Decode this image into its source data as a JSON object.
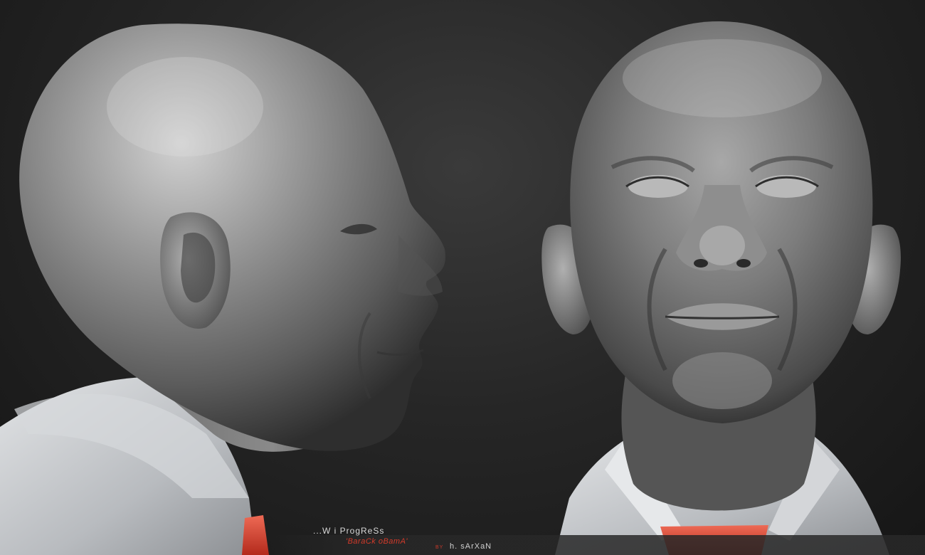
{
  "caption": {
    "wip": "...W i ProgReSs",
    "title": "'BaraCk oBamA'",
    "by": "BY",
    "author": "h. sArXaN"
  },
  "colors": {
    "background": "#262626",
    "clay": "#8c8c8c",
    "shirt": "#c9ccd0",
    "tie": "#d8402e",
    "caption_red": "#d23a2a",
    "caption_text": "#d8d8d8"
  },
  "icons": {
    "profile_view": "side-head-render",
    "front_view": "front-head-render"
  }
}
